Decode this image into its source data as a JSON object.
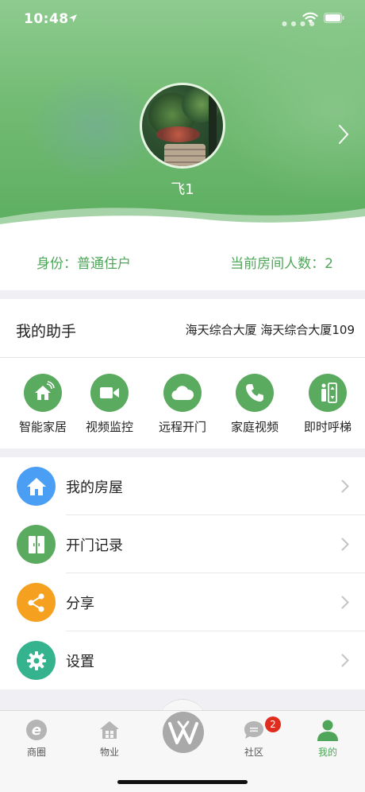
{
  "status_bar": {
    "time": "10:48"
  },
  "profile": {
    "username": "飞1"
  },
  "identity": {
    "role": "身份：普通住户",
    "room_count": "当前房间人数：2"
  },
  "assistant": {
    "title": "我的助手",
    "building": "海天综合大厦 海天综合大厦109",
    "tools": [
      {
        "label": "智能家居",
        "icon": "smart-home-icon"
      },
      {
        "label": "视频监控",
        "icon": "video-camera-icon"
      },
      {
        "label": "远程开门",
        "icon": "cloud-icon"
      },
      {
        "label": "家庭视频",
        "icon": "phone-icon"
      },
      {
        "label": "即时呼梯",
        "icon": "elevator-icon"
      }
    ]
  },
  "menu": {
    "items": [
      {
        "label": "我的房屋",
        "icon": "house-icon",
        "color": "#4a9ff5"
      },
      {
        "label": "开门记录",
        "icon": "door-icon",
        "color": "#5aaa5f"
      },
      {
        "label": "分享",
        "icon": "share-icon",
        "color": "#f5a01e"
      },
      {
        "label": "设置",
        "icon": "gear-icon",
        "color": "#35b38e"
      }
    ]
  },
  "tabbar": {
    "tabs": [
      {
        "label": "商圈",
        "icon": "shopping-e-icon"
      },
      {
        "label": "物业",
        "icon": "property-house-icon"
      },
      {
        "label": "社区",
        "icon": "chat-bubble-icon",
        "badge": "2"
      },
      {
        "label": "我的",
        "icon": "person-icon",
        "active": true
      }
    ]
  },
  "colors": {
    "accent": "#4fa65a",
    "header_green": "#6cb86e",
    "badge_red": "#e02b1f"
  }
}
